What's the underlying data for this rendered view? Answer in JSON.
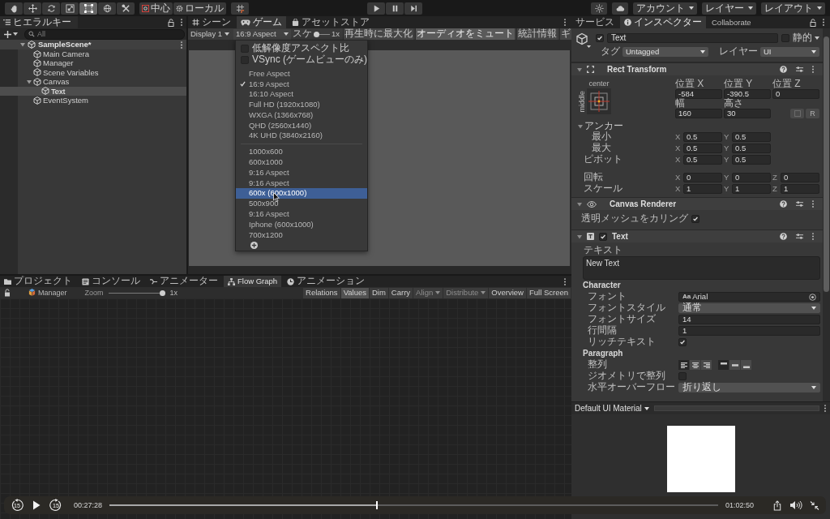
{
  "toolbar": {
    "tools": [
      {
        "kind": "hand",
        "selected": false
      },
      {
        "kind": "move",
        "selected": false
      },
      {
        "kind": "rotate",
        "selected": false
      },
      {
        "kind": "scale",
        "selected": false
      },
      {
        "kind": "rect",
        "selected": true
      },
      {
        "kind": "transform",
        "selected": false
      },
      {
        "kind": "custom",
        "selected": false
      }
    ],
    "handles": [
      {
        "kind": "pivot",
        "label": "中心"
      },
      {
        "kind": "space",
        "label": "ローカル"
      }
    ],
    "playback": [
      {
        "kind": "play"
      },
      {
        "kind": "pause"
      },
      {
        "kind": "step"
      }
    ],
    "menus": [
      {
        "label": "アカウント"
      },
      {
        "label": "レイヤー"
      },
      {
        "label": "レイアウト"
      }
    ]
  },
  "hierarchy": {
    "tab": "ヒエラルキー",
    "search": {
      "placeholder": "All"
    },
    "scene": {
      "label": "SampleScene*",
      "expanded": true,
      "children": [
        {
          "label": "Main Camera",
          "selected": false
        },
        {
          "label": "Manager",
          "selected": false
        },
        {
          "label": "Scene Variables",
          "selected": false
        },
        {
          "label": "Canvas",
          "selected": false,
          "expanded": true,
          "children": [
            {
              "label": "Text",
              "selected": true
            }
          ]
        },
        {
          "label": "EventSystem",
          "selected": false
        }
      ]
    }
  },
  "view_tabs": [
    {
      "kind": "scene",
      "label": "シーン",
      "selected": false
    },
    {
      "kind": "game",
      "label": "ゲーム",
      "selected": true
    },
    {
      "kind": "store",
      "label": "アセットストア",
      "selected": false
    }
  ],
  "game_toolbar": {
    "display": "Display 1",
    "aspect": "16:9 Aspect",
    "scale": {
      "label": "スケ",
      "level": 0,
      "reading": "1x"
    },
    "toggles": [
      {
        "label": "再生時に最大化",
        "on": false
      },
      {
        "label": "オーディオをミュート",
        "on": true
      },
      {
        "label": "統計情報",
        "on": false
      },
      {
        "label": "ギ",
        "on": false
      }
    ]
  },
  "aspect_menu": {
    "options": [
      {
        "label": "低解像度アスペクト比",
        "checked": false
      },
      {
        "label": "VSync (ゲームビューのみ)",
        "checked": false
      }
    ],
    "groups": [
      [
        {
          "label": "Free Aspect",
          "checked": false,
          "selected": false
        },
        {
          "label": "16:9 Aspect",
          "checked": true,
          "selected": false
        },
        {
          "label": "16:10 Aspect",
          "checked": false,
          "selected": false
        },
        {
          "label": "Full HD (1920x1080)",
          "checked": false,
          "selected": false
        },
        {
          "label": "WXGA (1366x768)",
          "checked": false,
          "selected": false
        },
        {
          "label": "QHD (2560x1440)",
          "checked": false,
          "selected": false
        },
        {
          "label": "4K UHD (3840x2160)",
          "checked": false,
          "selected": false
        }
      ],
      [
        {
          "label": "1000x600",
          "checked": false,
          "selected": false
        },
        {
          "label": "600x1000",
          "checked": false,
          "selected": false
        },
        {
          "label": "9:16 Aspect",
          "checked": false,
          "selected": false
        },
        {
          "label": "9:16 Aspect",
          "checked": false,
          "selected": false
        },
        {
          "label": "600x (600x1000)",
          "checked": false,
          "selected": true
        },
        {
          "label": "500x900",
          "checked": false,
          "selected": false
        },
        {
          "label": "9:16 Aspect",
          "checked": false,
          "selected": false
        },
        {
          "label": "Iphone (600x1000)",
          "checked": false,
          "selected": false
        },
        {
          "label": "700x1200",
          "checked": false,
          "selected": false
        }
      ]
    ]
  },
  "inspector": {
    "tabs": [
      {
        "kind": "plain",
        "label": "サービス",
        "selected": false
      },
      {
        "kind": "info",
        "label": "インスペクター",
        "selected": true
      },
      {
        "kind": "plain",
        "label": "Collaborate",
        "selected": false
      }
    ],
    "object": {
      "active": true,
      "name": "Text",
      "static": {
        "label": "静的",
        "checked": false
      },
      "tag": {
        "label": "タグ",
        "value": "Untagged"
      },
      "layer": {
        "label": "レイヤー",
        "value": "UI"
      }
    },
    "components": [
      {
        "kind": "rect_transform",
        "title": "Rect Transform",
        "expanded": true,
        "anchor_preset": {
          "horizontal": "center",
          "vertical": "middle"
        },
        "position": [
          {
            "label": "位置 X",
            "value": "-584"
          },
          {
            "label": "位置 Y",
            "value": "-390.5"
          },
          {
            "label": "位置 Z",
            "value": "0"
          }
        ],
        "size": [
          {
            "label": "幅",
            "value": "160"
          },
          {
            "label": "高さ",
            "value": "30"
          }
        ],
        "raw_button": "R",
        "anchors": {
          "label": "アンカー",
          "expanded": true,
          "rows": [
            {
              "label": "最小",
              "fields": [
                {
                  "axis": "X",
                  "value": "0.5"
                },
                {
                  "axis": "Y",
                  "value": "0.5"
                }
              ]
            },
            {
              "label": "最大",
              "fields": [
                {
                  "axis": "X",
                  "value": "0.5"
                },
                {
                  "axis": "Y",
                  "value": "0.5"
                }
              ]
            }
          ]
        },
        "pivot": {
          "label": "ピボット",
          "fields": [
            {
              "axis": "X",
              "value": "0.5"
            },
            {
              "axis": "Y",
              "value": "0.5"
            }
          ]
        },
        "transform_rows": [
          {
            "label": "回転",
            "fields": [
              {
                "axis": "X",
                "value": "0"
              },
              {
                "axis": "Y",
                "value": "0"
              },
              {
                "axis": "Z",
                "value": "0"
              }
            ]
          },
          {
            "label": "スケール",
            "fields": [
              {
                "axis": "X",
                "value": "1"
              },
              {
                "axis": "Y",
                "value": "1"
              },
              {
                "axis": "Z",
                "value": "1"
              }
            ]
          }
        ]
      },
      {
        "kind": "canvas_renderer",
        "title": "Canvas Renderer",
        "expanded": true,
        "rows": [
          {
            "kind": "checkbox",
            "label": "透明メッシュをカリング",
            "checked": true
          }
        ]
      },
      {
        "kind": "text",
        "title": "Text",
        "enabled": true,
        "expanded": true,
        "text": {
          "label": "テキスト",
          "value": "New Text"
        },
        "sections": [
          {
            "title": "Character",
            "rows": [
              {
                "kind": "object",
                "label": "フォント",
                "prefix": "Aa",
                "value": "Arial"
              },
              {
                "kind": "dropdown",
                "label": "フォントスタイル",
                "value": "通常"
              },
              {
                "kind": "field",
                "label": "フォントサイズ",
                "value": "14"
              },
              {
                "kind": "field",
                "label": "行間隔",
                "value": "1"
              },
              {
                "kind": "checkbox",
                "label": "リッチテキスト",
                "checked": true
              }
            ]
          },
          {
            "title": "Paragraph",
            "rows": [
              {
                "kind": "align",
                "label": "整列",
                "horizontal": [
                  {
                    "kind": "left",
                    "selected": true
                  },
                  {
                    "kind": "center",
                    "selected": false
                  },
                  {
                    "kind": "right",
                    "selected": false
                  }
                ],
                "vertical": [
                  {
                    "kind": "top",
                    "selected": true
                  },
                  {
                    "kind": "middle",
                    "selected": false
                  },
                  {
                    "kind": "bottom",
                    "selected": false
                  }
                ]
              },
              {
                "kind": "checkbox",
                "label": "ジオメトリで整列",
                "checked": false
              },
              {
                "kind": "dropdown",
                "label": "水平オーバーフロー",
                "value": "折り返し"
              }
            ]
          }
        ]
      }
    ],
    "material": {
      "name": "Default UI Material"
    }
  },
  "bottom_tabs": [
    {
      "kind": "folder",
      "label": "プロジェクト",
      "selected": false
    },
    {
      "kind": "console",
      "label": "コンソール",
      "selected": false
    },
    {
      "kind": "animator",
      "label": "アニメーター",
      "selected": false
    },
    {
      "kind": "graph",
      "label": "Flow Graph",
      "selected": true
    },
    {
      "kind": "clock",
      "label": "アニメーション",
      "selected": false
    }
  ],
  "graph_toolbar": {
    "target": "Manager",
    "zoom": {
      "label": "Zoom",
      "level": 1,
      "reading": "1x"
    },
    "buttons": [
      {
        "label": "Relations",
        "on": false,
        "disabled": false,
        "menu": false
      },
      {
        "label": "Values",
        "on": true,
        "disabled": false,
        "menu": false
      },
      {
        "label": "Dim",
        "on": false,
        "disabled": false,
        "menu": false
      },
      {
        "label": "Carry",
        "on": false,
        "disabled": false,
        "menu": false
      },
      {
        "label": "Align",
        "on": false,
        "disabled": true,
        "menu": true
      },
      {
        "label": "Distribute",
        "on": false,
        "disabled": true,
        "menu": true
      },
      {
        "label": "Overview",
        "on": false,
        "disabled": false,
        "menu": false
      },
      {
        "label": "Full Screen",
        "on": false,
        "disabled": false,
        "menu": false
      }
    ]
  },
  "player": {
    "skip_back": "15",
    "playing": false,
    "skip_forward": "15",
    "elapsed": "00:27:28",
    "level": 0.44,
    "duration": "01:02:50"
  }
}
